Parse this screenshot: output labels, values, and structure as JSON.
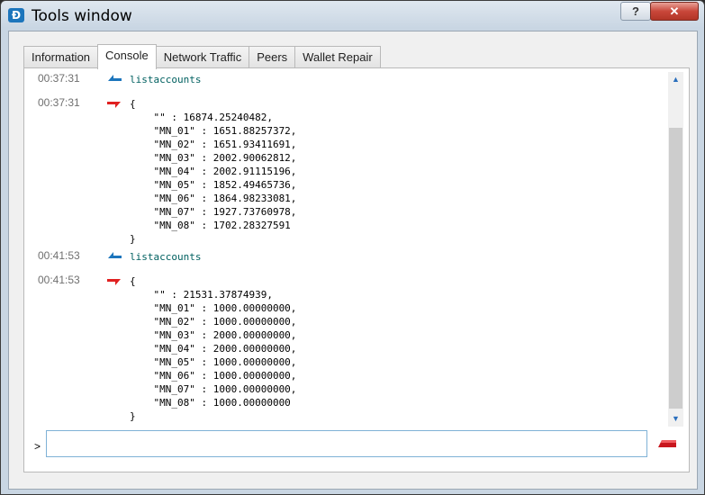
{
  "window": {
    "title": "Tools window",
    "help_label": "?",
    "close_label": "✕",
    "app_icon": "dash-logo-icon",
    "app_icon_glyph": "Đ"
  },
  "tabs": [
    {
      "label": "Information",
      "active": false
    },
    {
      "label": "Console",
      "active": true
    },
    {
      "label": "Network Traffic",
      "active": false
    },
    {
      "label": "Peers",
      "active": false
    },
    {
      "label": "Wallet Repair",
      "active": false
    }
  ],
  "console": {
    "entries": [
      {
        "time": "00:37:31",
        "direction": "request",
        "text": "listaccounts"
      },
      {
        "time": "00:37:31",
        "direction": "reply",
        "text": "{\n    \"\" : 16874.25240482,\n    \"MN_01\" : 1651.88257372,\n    \"MN_02\" : 1651.93411691,\n    \"MN_03\" : 2002.90062812,\n    \"MN_04\" : 2002.91115196,\n    \"MN_05\" : 1852.49465736,\n    \"MN_06\" : 1864.98233081,\n    \"MN_07\" : 1927.73760978,\n    \"MN_08\" : 1702.28327591\n}"
      },
      {
        "time": "00:41:53",
        "direction": "request",
        "text": "listaccounts"
      },
      {
        "time": "00:41:53",
        "direction": "reply",
        "text": "{\n    \"\" : 21531.37874939,\n    \"MN_01\" : 1000.00000000,\n    \"MN_02\" : 1000.00000000,\n    \"MN_03\" : 2000.00000000,\n    \"MN_04\" : 2000.00000000,\n    \"MN_05\" : 1000.00000000,\n    \"MN_06\" : 1000.00000000,\n    \"MN_07\" : 1000.00000000,\n    \"MN_08\" : 1000.00000000\n}"
      }
    ],
    "prompt": ">",
    "input_value": "",
    "colors": {
      "request_arrow": "#1c75bc",
      "reply_arrow": "#e02020",
      "command_text": "#006060"
    }
  }
}
